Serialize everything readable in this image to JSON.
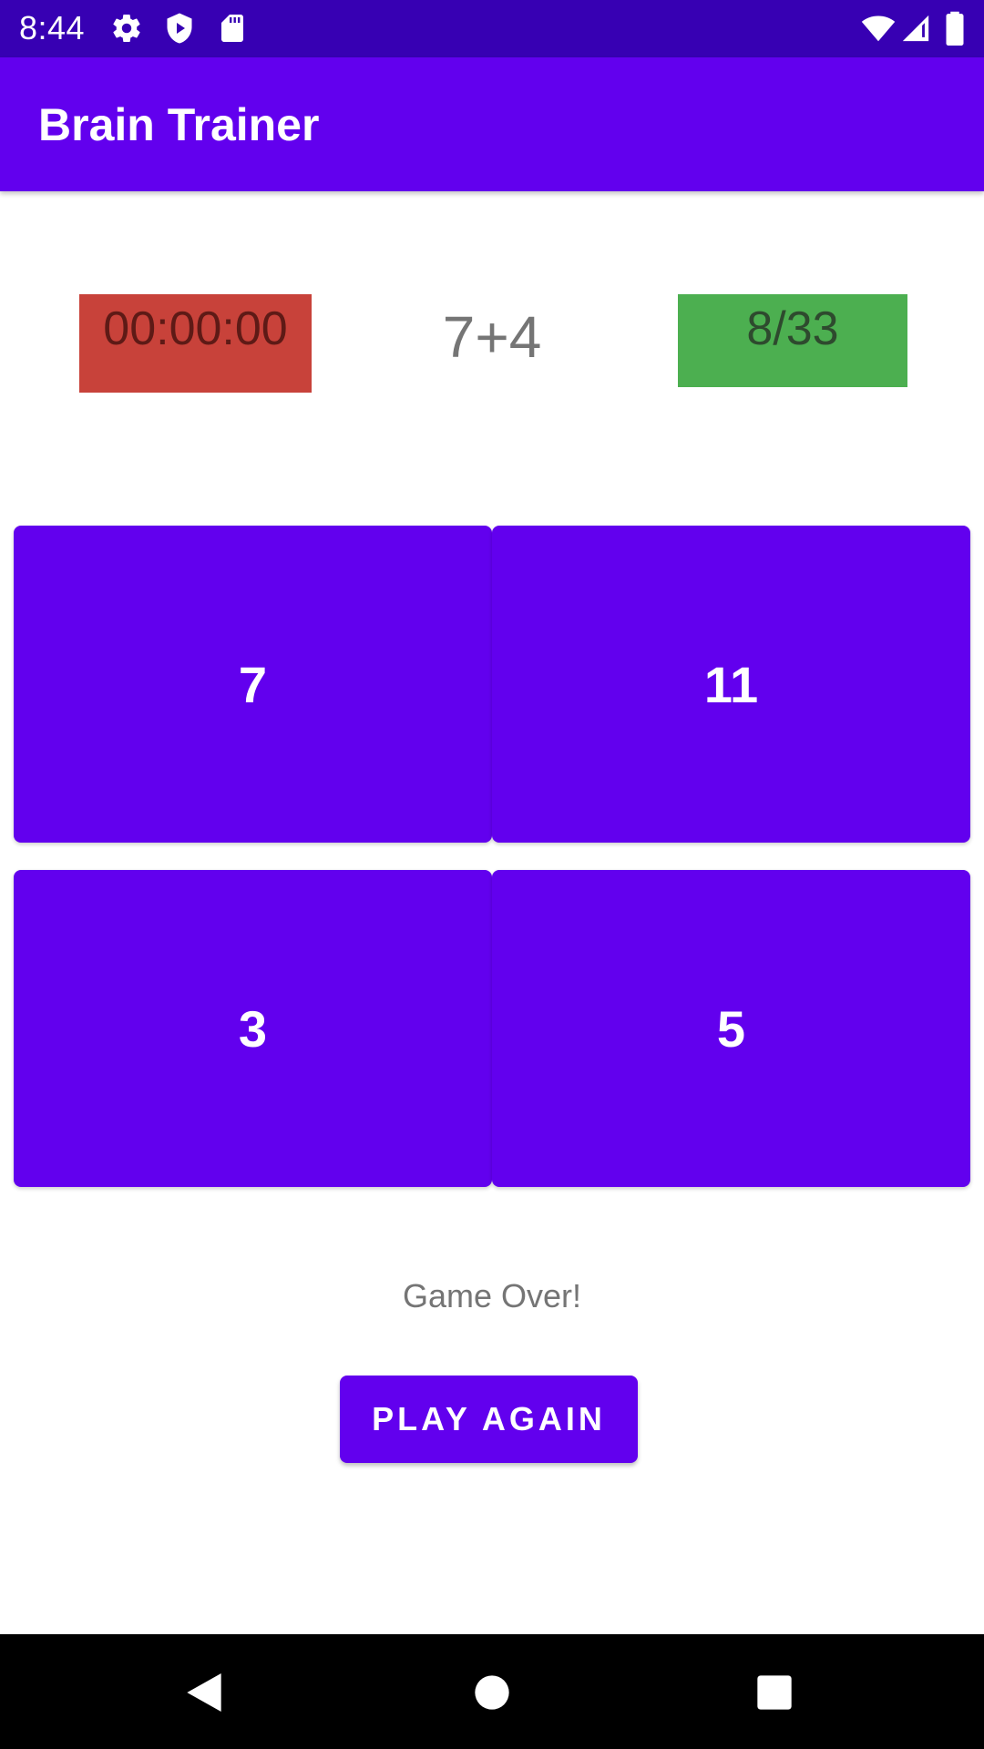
{
  "status_bar": {
    "time": "8:44",
    "icons": [
      "settings-icon",
      "shield-play-icon",
      "sd-card-icon",
      "wifi-icon",
      "signal-icon",
      "battery-icon"
    ]
  },
  "app_bar": {
    "title": "Brain Trainer"
  },
  "game": {
    "timer": "00:00:00",
    "question": "7+4",
    "score": "8/33",
    "answers": [
      "7",
      "11",
      "3",
      "5"
    ],
    "result": "Game Over!",
    "play_again_label": "PLAY AGAIN"
  },
  "nav_bar": {
    "icons": [
      "back-icon",
      "home-icon",
      "recents-icon"
    ]
  },
  "colors": {
    "status_bar": "#3700b3",
    "primary": "#6200ee",
    "timer_bg": "#c8423a",
    "score_bg": "#4caf50"
  }
}
